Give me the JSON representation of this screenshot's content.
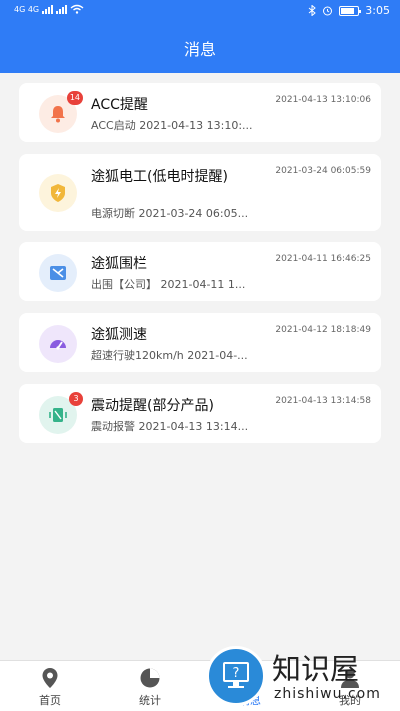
{
  "status_bar": {
    "left_text": "4G 4G",
    "time": "3:05"
  },
  "header": {
    "title": "消息"
  },
  "messages": [
    {
      "title": "ACC提醒",
      "time": "2021-04-13 13:10:06",
      "subtitle": "ACC启动 2021-04-13 13:10:...",
      "badge": "14",
      "icon": "bell-icon",
      "icon_bg": "#fdece4",
      "icon_color": "#f2734a"
    },
    {
      "title": "途狐电工(低电时提醒)",
      "time": "2021-03-24 06:05:59",
      "subtitle": "电源切断 2021-03-24 06:05...",
      "badge": "",
      "icon": "power-shield-icon",
      "icon_bg": "#fdf4dc",
      "icon_color": "#f1b73a"
    },
    {
      "title": "途狐围栏",
      "time": "2021-04-11 16:46:25",
      "subtitle": "出围【公司】 2021-04-11 1...",
      "badge": "",
      "icon": "fence-icon",
      "icon_bg": "#e4eefb",
      "icon_color": "#4b8fe6"
    },
    {
      "title": "途狐测速",
      "time": "2021-04-12 18:18:49",
      "subtitle": "超速行驶120km/h 2021-04-...",
      "badge": "",
      "icon": "speedometer-icon",
      "icon_bg": "#efe6fb",
      "icon_color": "#8a5ce0"
    },
    {
      "title": "震动提醒(部分产品)",
      "time": "2021-04-13 13:14:58",
      "subtitle": "震动报警 2021-04-13 13:14...",
      "badge": "3",
      "icon": "vibration-icon",
      "icon_bg": "#e1f4ee",
      "icon_color": "#35b38a"
    }
  ],
  "tabbar": {
    "tabs": [
      {
        "label": "首页",
        "icon": "location-pin-icon"
      },
      {
        "label": "统计",
        "icon": "pie-chart-icon"
      },
      {
        "label": "消息",
        "icon": "message-icon"
      },
      {
        "label": "我的",
        "icon": "user-icon"
      }
    ],
    "active_color": "#2f7cf6"
  },
  "watermark": {
    "text": "知识屋",
    "sub": "zhishiwu.com"
  },
  "colors": {
    "primary": "#2f7cf6",
    "background": "#f3f3f3",
    "badge": "#e8413a"
  }
}
